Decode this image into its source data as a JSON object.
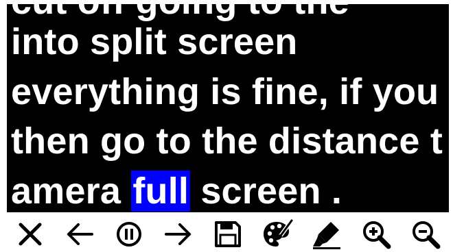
{
  "reader": {
    "lines": [
      {
        "text": "cut off going to the"
      },
      {
        "text": "into split screen"
      },
      {
        "text": "everything is fine, if you"
      },
      {
        "text": "then go to the distance t"
      },
      {
        "before": "amera ",
        "highlight": "full",
        "after": " screen ."
      }
    ],
    "colors": {
      "background": "#000000",
      "text": "#ffffff",
      "highlight": "#0000ff"
    }
  },
  "toolbar": {
    "icons": [
      "close-icon",
      "arrow-left-icon",
      "pause-icon",
      "arrow-right-icon",
      "save-icon",
      "palette-icon",
      "highlighter-icon",
      "zoom-in-icon",
      "zoom-out-icon"
    ]
  }
}
